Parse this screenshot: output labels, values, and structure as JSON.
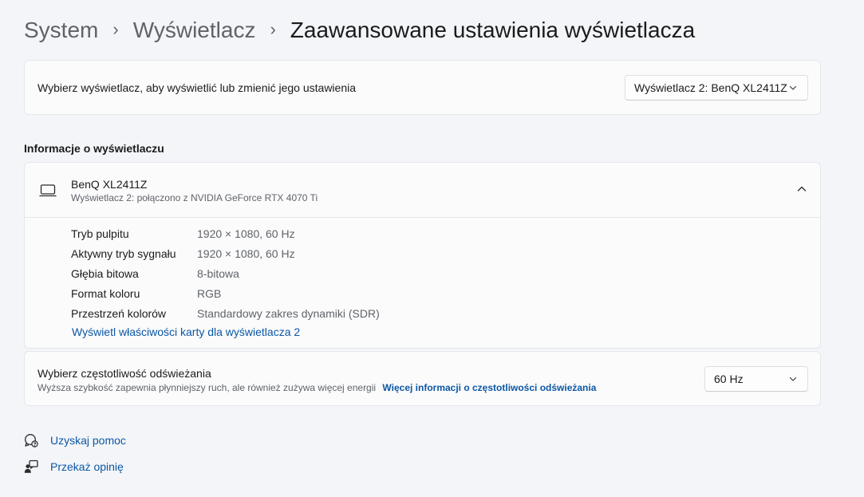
{
  "breadcrumb": {
    "items": [
      "System",
      "Wyświetlacz"
    ],
    "current": "Zaawansowane ustawienia wyświetlacza",
    "separator": "›"
  },
  "display_select": {
    "label": "Wybierz wyświetlacz, aby wyświetlić lub zmienić jego ustawienia",
    "selected": "Wyświetlacz 2: BenQ XL2411Z"
  },
  "display_info": {
    "section_title": "Informacje o wyświetlaczu",
    "device_name": "BenQ XL2411Z",
    "device_subtitle": "Wyświetlacz 2: połączono z NVIDIA GeForce RTX 4070 Ti",
    "properties": [
      {
        "label": "Tryb pulpitu",
        "value": "1920 × 1080, 60 Hz"
      },
      {
        "label": "Aktywny tryb sygnału",
        "value": "1920 × 1080, 60 Hz"
      },
      {
        "label": "Głębia bitowa",
        "value": "8-bitowa"
      },
      {
        "label": "Format koloru",
        "value": "RGB"
      },
      {
        "label": "Przestrzeń kolorów",
        "value": "Standardowy zakres dynamiki (SDR)"
      }
    ],
    "adapter_link": "Wyświetl właściwości karty dla wyświetlacza 2"
  },
  "refresh_rate": {
    "title": "Wybierz częstotliwość odświeżania",
    "description": "Wyższa szybkość zapewnia płynniejszy ruch, ale również zużywa więcej energii",
    "more_info_link": "Więcej informacji o częstotliwości odświeżania",
    "selected": "60 Hz"
  },
  "footer": {
    "help": "Uzyskaj pomoc",
    "feedback": "Przekaż opinię"
  },
  "icons": {
    "display": "monitor-icon",
    "collapse": "chevron-up-icon",
    "dropdown": "chevron-down-icon",
    "help": "help-chat-icon",
    "feedback": "feedback-person-icon"
  },
  "colors": {
    "background": "#f3f5f9",
    "card": "#fbfbfc",
    "link": "#0b57a4",
    "secondary_text": "#5f6368"
  }
}
